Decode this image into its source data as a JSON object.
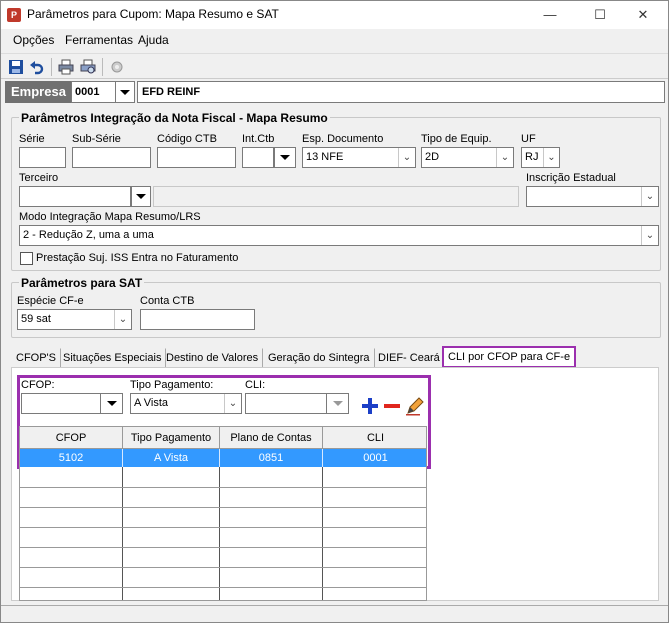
{
  "window": {
    "title": "Parâmetros para Cupom: Mapa Resumo e SAT"
  },
  "menu": {
    "opcoes": "Opções",
    "ferramentas": "Ferramentas",
    "ajuda": "Ajuda"
  },
  "empresa": {
    "label": "Empresa",
    "code": "0001",
    "name": "EFD REINF"
  },
  "mapa_resumo": {
    "title": "Parâmetros Integração da Nota Fiscal - Mapa Resumo",
    "serie_label": "Série",
    "serie_value": "",
    "subserie_label": "Sub-Série",
    "subserie_value": "",
    "codigo_ctb_label": "Código CTB",
    "codigo_ctb_value": "",
    "int_ctb_label": "Int.Ctb",
    "int_ctb_value": "",
    "esp_documento_label": "Esp. Documento",
    "esp_documento_value": "13 NFE",
    "tipo_equip_label": "Tipo de Equip.",
    "tipo_equip_value": "2D",
    "uf_label": "UF",
    "uf_value": "RJ",
    "terceiro_label": "Terceiro",
    "terceiro_value": "",
    "inscricao_label": "Inscrição Estadual",
    "inscricao_value": "",
    "modo_label": "Modo Integração Mapa Resumo/LRS",
    "modo_value": "2 - Redução Z, uma a uma",
    "iss_label": "Prestação Suj. ISS Entra no Faturamento",
    "iss_checked": false
  },
  "sat": {
    "title": "Parâmetros para SAT",
    "especie_label": "Espécie CF-e",
    "especie_value": "59 sat",
    "conta_label": "Conta CTB",
    "conta_value": ""
  },
  "tabs": [
    {
      "label": "CFOP'S"
    },
    {
      "label": "Situações Especiais"
    },
    {
      "label": "Destino de Valores"
    },
    {
      "label": "Geração do Sintegra"
    },
    {
      "label": "DIEF- Ceará"
    },
    {
      "label": "CLI por CFOP para CF-e"
    }
  ],
  "cli_form": {
    "cfop_label": "CFOP:",
    "cfop_value": "",
    "tipo_pagamento_label": "Tipo Pagamento:",
    "tipo_pagamento_value": "A Vista",
    "cli_label": "CLI:",
    "cli_value": ""
  },
  "grid": {
    "columns": [
      "CFOP",
      "Tipo Pagamento",
      "Plano de Contas",
      "CLI"
    ],
    "rows": [
      [
        "5102",
        "A Vista",
        "0851",
        "0001"
      ]
    ]
  },
  "colors": {
    "accent_border": "#9b2fae",
    "selected_row": "#3399ff",
    "add": "#1c3fc7",
    "remove": "#e0261d"
  }
}
